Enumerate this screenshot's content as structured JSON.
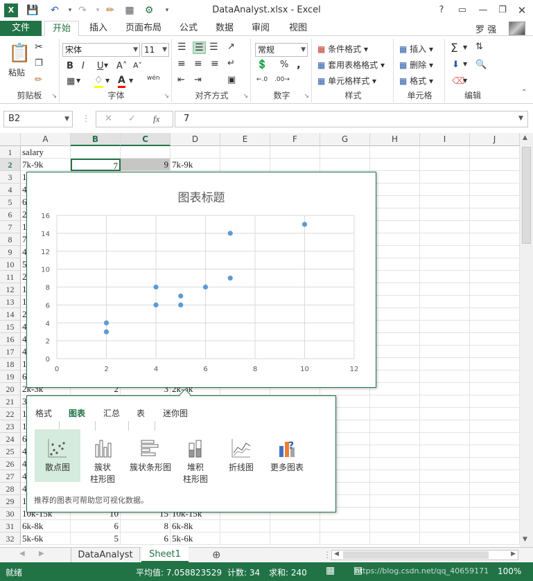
{
  "app": {
    "title": "DataAnalyst.xlsx - Excel",
    "user": "罗 强"
  },
  "colors": {
    "accent": "#217346",
    "series": "#5b9bd5"
  },
  "tabs": [
    {
      "label": "文件"
    },
    {
      "label": "开始"
    },
    {
      "label": "插入"
    },
    {
      "label": "页面布局"
    },
    {
      "label": "公式"
    },
    {
      "label": "数据"
    },
    {
      "label": "审阅"
    },
    {
      "label": "视图"
    }
  ],
  "ribbon": {
    "clipboard": {
      "label": "剪贴板",
      "paste": "粘贴"
    },
    "font": {
      "label": "字体",
      "name": "宋体",
      "size": "11",
      "bold": "B",
      "italic": "I",
      "underline": "U",
      "color_a": "A",
      "wen": "wén"
    },
    "align": {
      "label": "对齐方式"
    },
    "number": {
      "label": "数字",
      "format": "常规",
      "percent": "%",
      "comma": ","
    },
    "styles": {
      "label": "样式",
      "cond": "条件格式",
      "table": "套用表格格式",
      "cell": "单元格样式"
    },
    "cells": {
      "label": "单元格",
      "insert": "插入",
      "delete": "删除",
      "format": "格式"
    },
    "edit": {
      "label": "编辑"
    }
  },
  "formula": {
    "namebox": "B2",
    "value": "7",
    "fx": "fx"
  },
  "columns": [
    "A",
    "B",
    "C",
    "D",
    "E",
    "F",
    "G",
    "H",
    "I",
    "J"
  ],
  "rows": [
    {
      "n": "1",
      "a": "salary",
      "b": "",
      "c": "",
      "d": ""
    },
    {
      "n": "2",
      "a": "7k-9k",
      "b": "7",
      "c": "9",
      "d": "7k-9k"
    },
    {
      "n": "3",
      "a": "1",
      "b": "",
      "c": "",
      "d": ""
    },
    {
      "n": "4",
      "a": "4",
      "b": "",
      "c": "",
      "d": ""
    },
    {
      "n": "5",
      "a": "6",
      "b": "",
      "c": "",
      "d": ""
    },
    {
      "n": "6",
      "a": "2",
      "b": "",
      "c": "",
      "d": ""
    },
    {
      "n": "7",
      "a": "1",
      "b": "",
      "c": "",
      "d": ""
    },
    {
      "n": "8",
      "a": "7",
      "b": "",
      "c": "",
      "d": ""
    },
    {
      "n": "9",
      "a": "4",
      "b": "",
      "c": "",
      "d": ""
    },
    {
      "n": "10",
      "a": "5",
      "b": "",
      "c": "",
      "d": ""
    },
    {
      "n": "11",
      "a": "2",
      "b": "",
      "c": "",
      "d": ""
    },
    {
      "n": "12",
      "a": "1",
      "b": "",
      "c": "",
      "d": ""
    },
    {
      "n": "13",
      "a": "1",
      "b": "",
      "c": "",
      "d": ""
    },
    {
      "n": "14",
      "a": "2",
      "b": "",
      "c": "",
      "d": ""
    },
    {
      "n": "15",
      "a": "4",
      "b": "",
      "c": "",
      "d": ""
    },
    {
      "n": "16",
      "a": "4",
      "b": "",
      "c": "",
      "d": ""
    },
    {
      "n": "17",
      "a": "4",
      "b": "",
      "c": "",
      "d": ""
    },
    {
      "n": "18",
      "a": "1",
      "b": "",
      "c": "",
      "d": ""
    },
    {
      "n": "19",
      "a": "6",
      "b": "",
      "c": "",
      "d": ""
    },
    {
      "n": "20",
      "a": "2k-3k",
      "b": "2",
      "c": "3",
      "d": "2k-3k"
    },
    {
      "n": "21",
      "a": "3",
      "b": "",
      "c": "",
      "d": ""
    },
    {
      "n": "22",
      "a": "1",
      "b": "",
      "c": "",
      "d": ""
    },
    {
      "n": "23",
      "a": "1",
      "b": "",
      "c": "",
      "d": ""
    },
    {
      "n": "24",
      "a": "6",
      "b": "",
      "c": "",
      "d": ""
    },
    {
      "n": "25",
      "a": "4",
      "b": "",
      "c": "",
      "d": ""
    },
    {
      "n": "26",
      "a": "4",
      "b": "",
      "c": "",
      "d": ""
    },
    {
      "n": "27",
      "a": "4",
      "b": "",
      "c": "",
      "d": ""
    },
    {
      "n": "28",
      "a": "4",
      "b": "",
      "c": "",
      "d": ""
    },
    {
      "n": "29",
      "a": "1",
      "b": "",
      "c": "",
      "d": ""
    },
    {
      "n": "30",
      "a": "10k-15k",
      "b": "10",
      "c": "15",
      "d": "10k-15k"
    },
    {
      "n": "31",
      "a": "6k-8k",
      "b": "6",
      "c": "8",
      "d": "6k-8k"
    },
    {
      "n": "32",
      "a": "5k-6k",
      "b": "5",
      "c": "6",
      "d": "5k-6k"
    }
  ],
  "chart_data": {
    "type": "scatter",
    "title": "图表标题",
    "x": [
      7,
      2,
      2,
      4,
      4,
      5,
      5,
      6,
      7,
      10
    ],
    "y": [
      9,
      3,
      4,
      6,
      8,
      6,
      7,
      8,
      14,
      15
    ],
    "xlim": [
      0,
      12
    ],
    "ylim": [
      0,
      16
    ],
    "xticks": [
      "0",
      "2",
      "4",
      "6",
      "8",
      "10",
      "12"
    ],
    "yticks": [
      "0",
      "2",
      "4",
      "6",
      "8",
      "10",
      "12",
      "14",
      "16"
    ],
    "grid": true
  },
  "quick": {
    "tabs": [
      {
        "label": "格式"
      },
      {
        "label": "图表"
      },
      {
        "label": "汇总"
      },
      {
        "label": "表"
      },
      {
        "label": "迷你图"
      }
    ],
    "items": [
      {
        "label": "散点图"
      },
      {
        "label": "簇状\n柱形图"
      },
      {
        "label": "簇状条形图"
      },
      {
        "label": "堆积\n柱形图"
      },
      {
        "label": "折线图"
      },
      {
        "label": "更多图表"
      }
    ],
    "hint": "推荐的图表可帮助您可视化数据。"
  },
  "sheets": [
    {
      "label": "DataAnalyst"
    },
    {
      "label": "Sheet1"
    }
  ],
  "status": {
    "ready": "就绪",
    "avg": "平均值: 7.058823529",
    "count": "计数: 34",
    "sum": "求和: 240",
    "zoom": "100%",
    "watermark": "https://blog.csdn.net/qq_40659171"
  }
}
